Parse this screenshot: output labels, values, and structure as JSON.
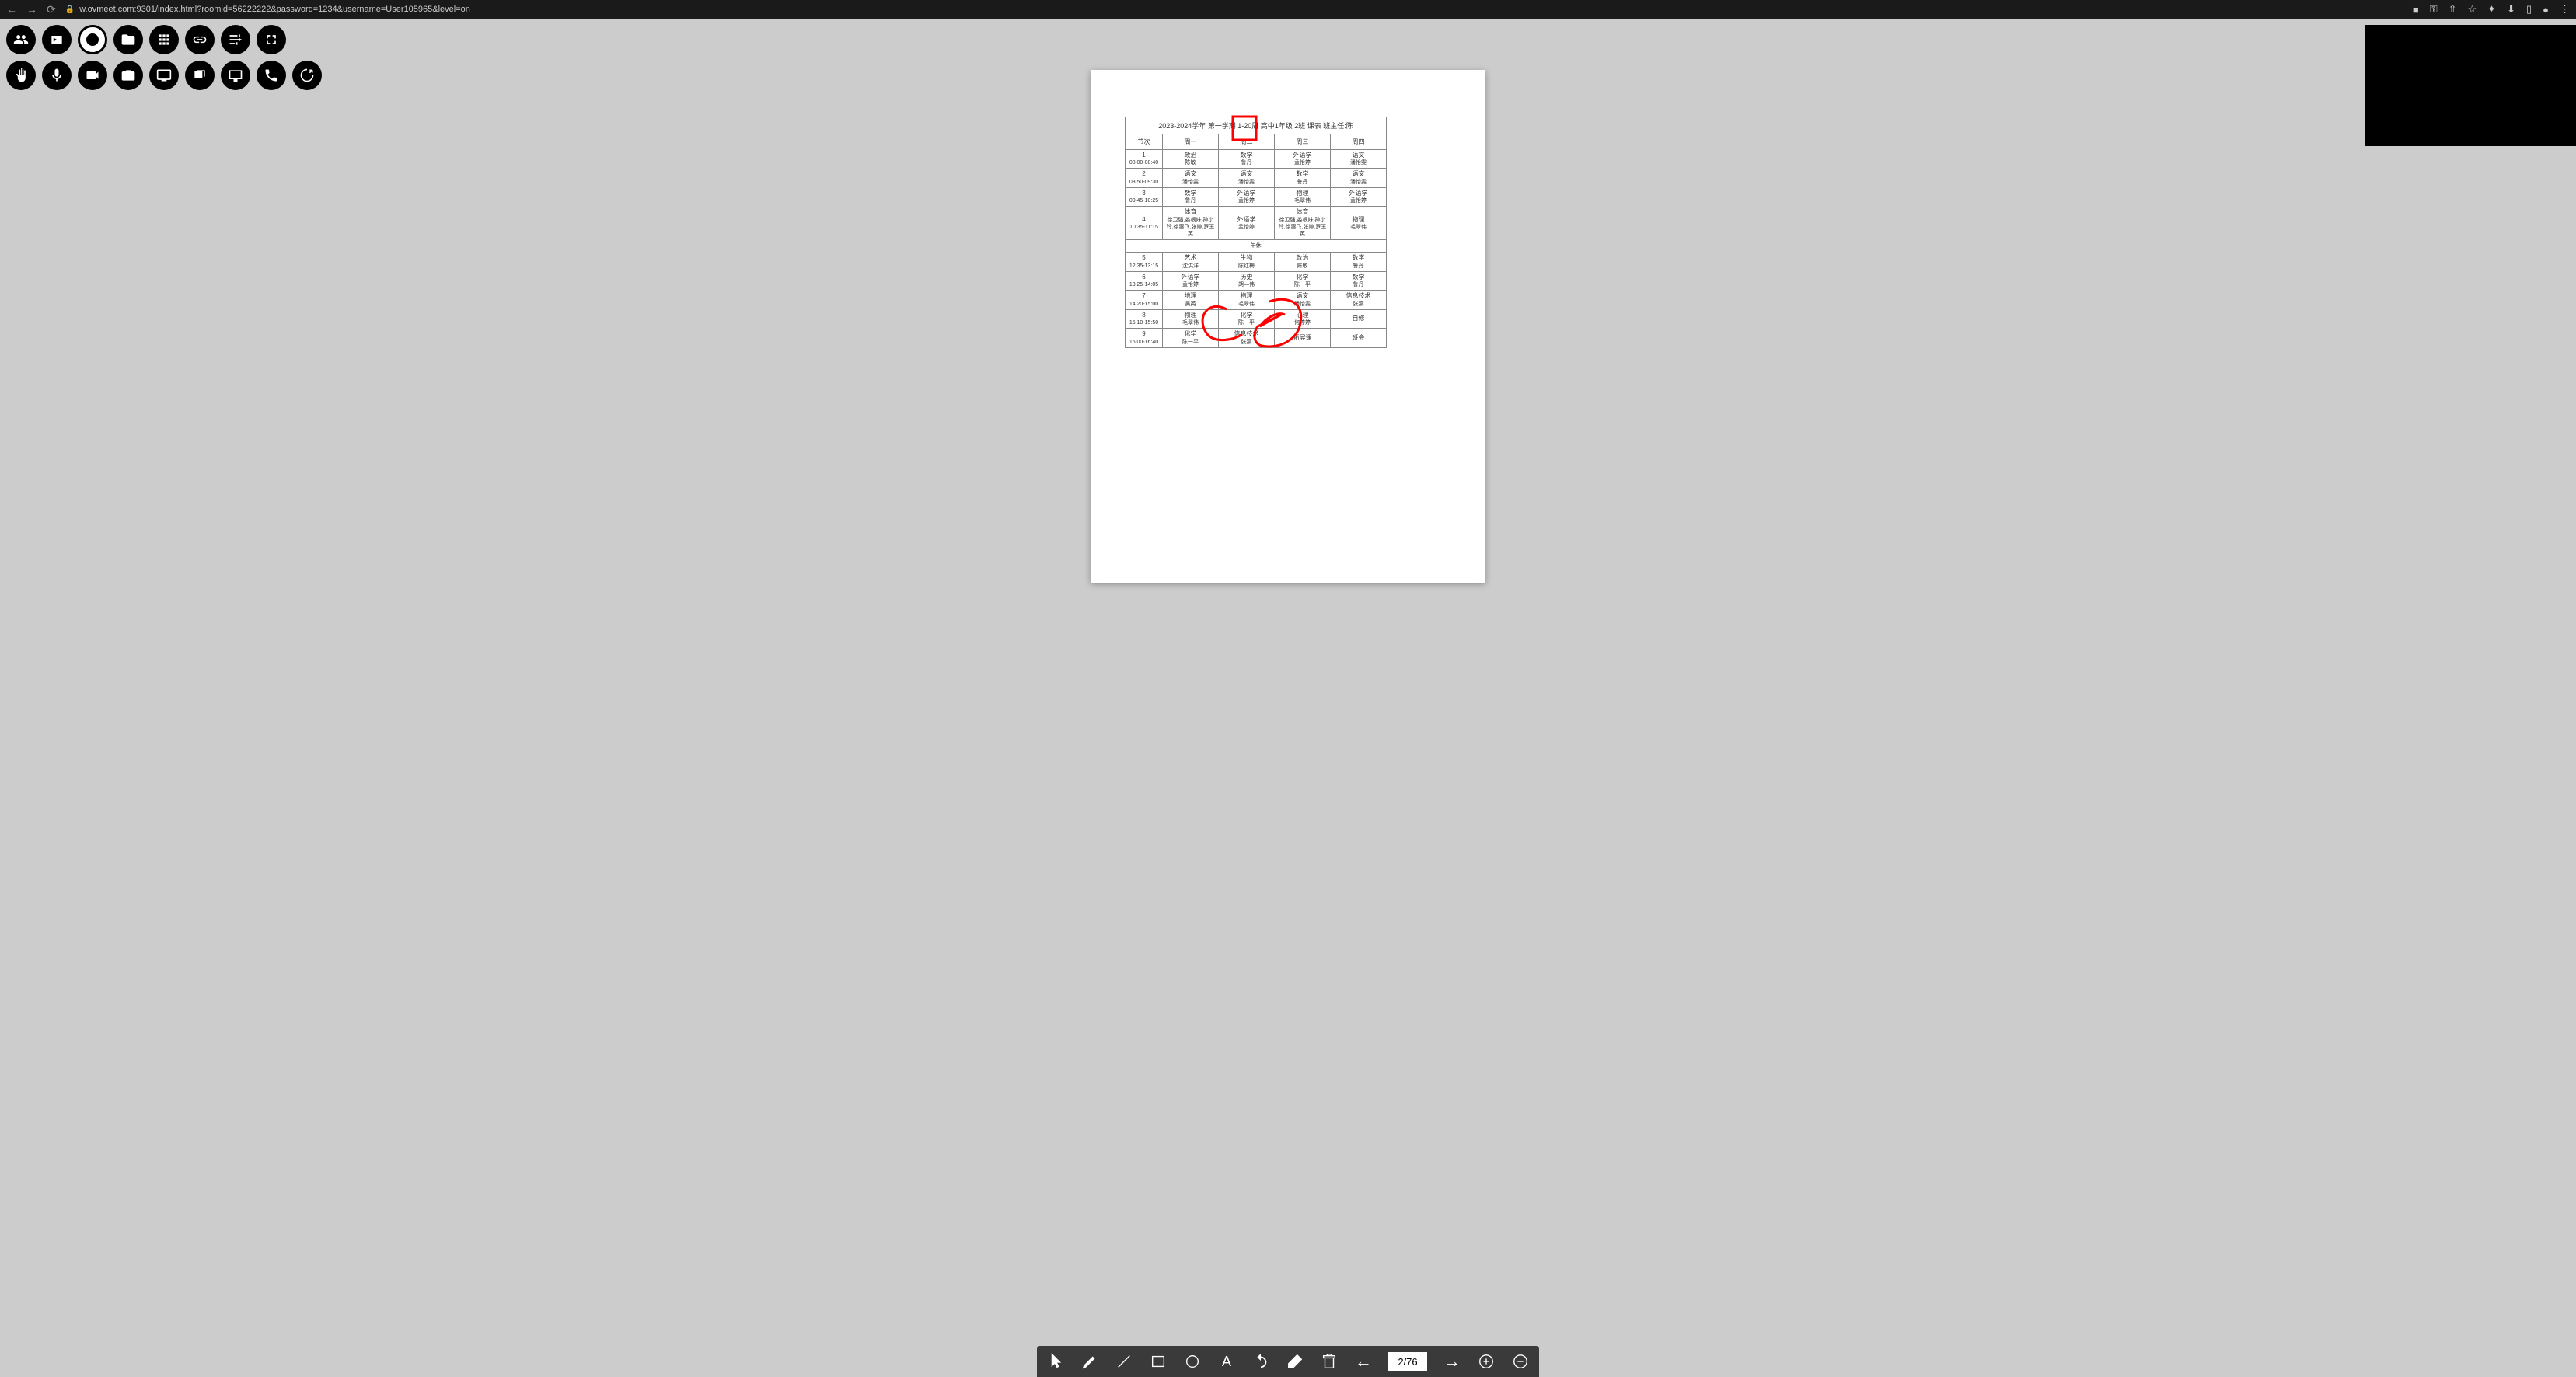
{
  "browser": {
    "url": "w.ovmeet.com:9301/index.html?roomid=56222222&password=1234&username=User105965&level=on"
  },
  "schedule": {
    "title": "2023-2024学年  第一学期  1-20周  高中1年级  2班  课表      班主任:陈",
    "headers": [
      "节次",
      "周一",
      "周二",
      "周三",
      "周四"
    ],
    "lunch": "午休",
    "rows": [
      {
        "period": "1",
        "time": "08:00-08:40",
        "cells": [
          {
            "s": "政治",
            "t": "陈敏"
          },
          {
            "s": "数学",
            "t": "鲁丹"
          },
          {
            "s": "外语学",
            "t": "孟怡婷"
          },
          {
            "s": "语文",
            "t": "潘怡雯"
          }
        ]
      },
      {
        "period": "2",
        "time": "08:50-09:30",
        "cells": [
          {
            "s": "语文",
            "t": "潘怡雯"
          },
          {
            "s": "语文",
            "t": "潘怡雯"
          },
          {
            "s": "数学",
            "t": "鲁丹"
          },
          {
            "s": "语文",
            "t": "潘怡雯"
          }
        ]
      },
      {
        "period": "3",
        "time": "09:45-10:25",
        "cells": [
          {
            "s": "数学",
            "t": "鲁丹"
          },
          {
            "s": "外语学",
            "t": "孟怡婷"
          },
          {
            "s": "物理",
            "t": "毛翠伟"
          },
          {
            "s": "外语学",
            "t": "孟怡婷"
          }
        ]
      },
      {
        "period": "4",
        "time": "10:35-11:15",
        "cells": [
          {
            "s": "体育",
            "t": "徐卫强,娄根妹,孙小玲,徐惠飞,张婷,罗玉英"
          },
          {
            "s": "外语学",
            "t": "孟怡婷"
          },
          {
            "s": "体育",
            "t": "徐卫强,娄根妹,孙小玲,徐惠飞,张婷,罗玉英"
          },
          {
            "s": "物理",
            "t": "毛翠伟"
          }
        ]
      },
      {
        "period": "5",
        "time": "12:35-13:15",
        "cells": [
          {
            "s": "艺术",
            "t": "沈洪洋"
          },
          {
            "s": "生物",
            "t": "陈红梅"
          },
          {
            "s": "政治",
            "t": "陈敏"
          },
          {
            "s": "数学",
            "t": "鲁丹"
          }
        ]
      },
      {
        "period": "6",
        "time": "13:25-14:05",
        "cells": [
          {
            "s": "外语学",
            "t": "孟怡婷"
          },
          {
            "s": "历史",
            "t": "胡—伟"
          },
          {
            "s": "化学",
            "t": "陈一平"
          },
          {
            "s": "数学",
            "t": "鲁丹"
          }
        ]
      },
      {
        "period": "7",
        "time": "14:20-15:00",
        "cells": [
          {
            "s": "地理",
            "t": "吴英"
          },
          {
            "s": "物理",
            "t": "毛翠伟"
          },
          {
            "s": "语文",
            "t": "潘怡雯"
          },
          {
            "s": "信息技术",
            "t": "张燕"
          }
        ]
      },
      {
        "period": "8",
        "time": "15:10-15:50",
        "cells": [
          {
            "s": "物理",
            "t": "毛翠伟"
          },
          {
            "s": "化学",
            "t": "陈一平"
          },
          {
            "s": "心理",
            "t": "何婷婷"
          },
          {
            "s": "自修",
            "t": ""
          }
        ]
      },
      {
        "period": "9",
        "time": "16:00-16:40",
        "cells": [
          {
            "s": "化学",
            "t": "陈一平"
          },
          {
            "s": "信息技术",
            "t": "张燕"
          },
          {
            "s": "拓展课",
            "t": ""
          },
          {
            "s": "班会",
            "t": ""
          }
        ]
      }
    ]
  },
  "pagination": {
    "current": "2/76"
  }
}
